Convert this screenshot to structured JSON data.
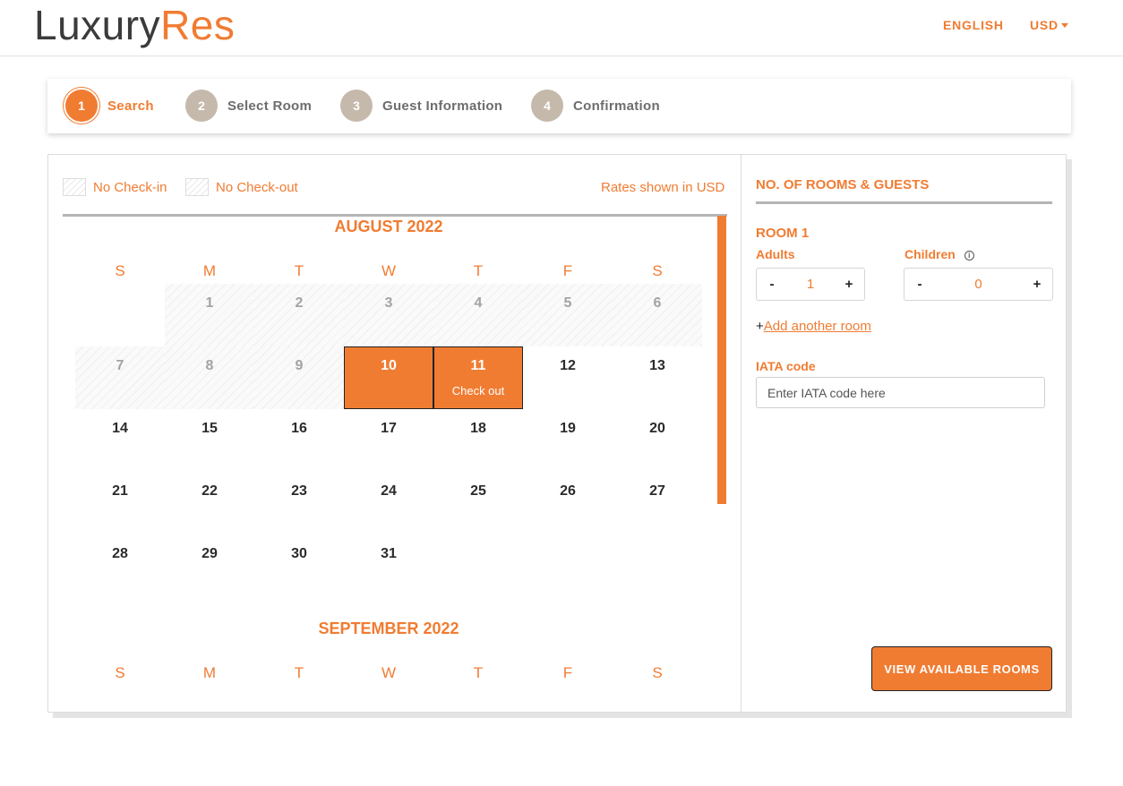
{
  "header": {
    "logo_part1": "Luxury",
    "logo_part2": "Res",
    "language": "ENGLISH",
    "currency": "USD"
  },
  "steps": [
    {
      "number": "1",
      "label": "Search",
      "active": true
    },
    {
      "number": "2",
      "label": "Select Room",
      "active": false
    },
    {
      "number": "3",
      "label": "Guest Information",
      "active": false
    },
    {
      "number": "4",
      "label": "Confirmation",
      "active": false
    }
  ],
  "calendar": {
    "legend_no_checkin": "No Check-in",
    "legend_no_checkout": "No Check-out",
    "rates_note": "Rates shown in USD",
    "weekdays": [
      "S",
      "M",
      "T",
      "W",
      "T",
      "F",
      "S"
    ],
    "months": [
      {
        "title": "AUGUST 2022",
        "first_weekday": 1,
        "days": 31,
        "unavailable_through": 9,
        "selected": [
          10,
          11
        ],
        "day_notes": {
          "11": "Check out"
        }
      },
      {
        "title": "SEPTEMBER 2022"
      }
    ]
  },
  "booking": {
    "section_title": "NO. OF ROOMS & GUESTS",
    "room_title": "ROOM 1",
    "adults_label": "Adults",
    "adults_value": "1",
    "children_label": "Children",
    "children_value": "0",
    "info_icon_glyph": "i",
    "minus": "-",
    "plus": "+",
    "add_room_prefix": "+",
    "add_room_link": "Add another room",
    "iata_label": "IATA code",
    "iata_placeholder": "Enter IATA code here",
    "iata_value": "",
    "submit_label": "VIEW AVAILABLE ROOMS"
  },
  "colors": {
    "accent": "#f07c32",
    "step_inactive": "#c5b9ab",
    "text_dark": "#2b2b2b",
    "text_muted": "#a3a3a3"
  }
}
